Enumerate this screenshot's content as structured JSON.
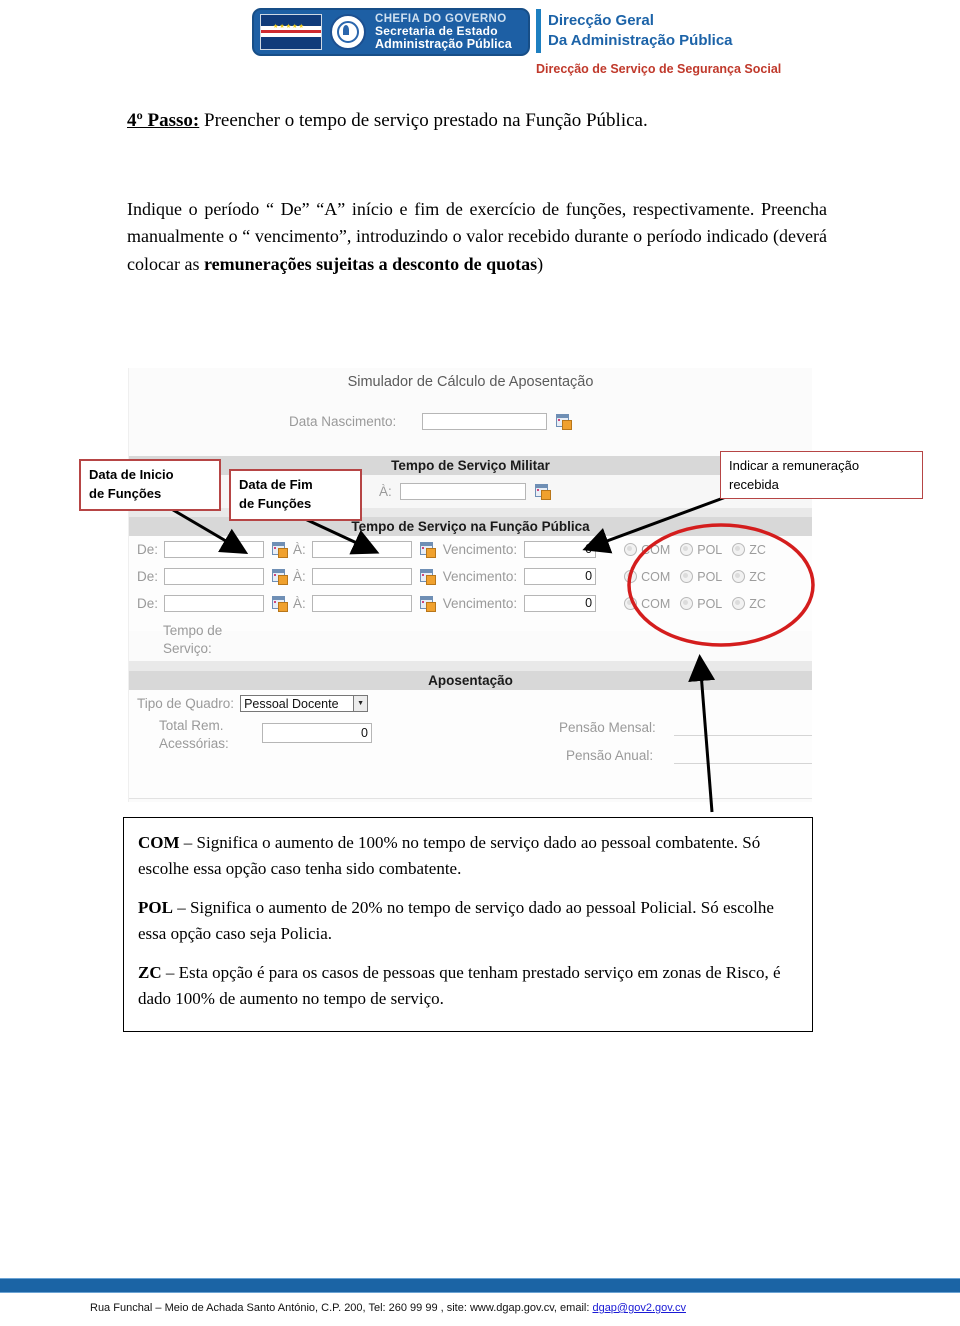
{
  "header": {
    "logo_line1": "CHEFIA DO GOVERNO",
    "logo_line2": "Secretaria de Estado",
    "logo_line3": "Administração Pública",
    "dg_line1": "Direcção Geral",
    "dg_line2": "Da Administração Pública",
    "service_line": "Direcção de Serviço de Segurança Social",
    "brand_blue": "#1d5fa4",
    "brand_red": "#c0392b"
  },
  "document": {
    "step_label": "4º Passo:",
    "step_text": " Preencher o tempo de serviço prestado na Função Pública.",
    "paragraph_part1": "Indique o período “ De” “A” início e fim de exercício de funções, respectivamente. Preencha manualmente o “ vencimento”, introduzindo o valor recebido durante o período indicado (deverá colocar as ",
    "paragraph_bold": "remunerações sujeitas a desconto de quotas",
    "paragraph_part2": ")"
  },
  "app": {
    "title": "Simulador de Cálculo de Aposentação",
    "birth_label": "Data Nascimento:",
    "birth_value": "",
    "military_band": "Tempo de Serviço Militar",
    "military_to_label": "À:",
    "military_to_value": "",
    "public_band": "Tempo de Serviço na Função Pública",
    "rows": [
      {
        "from_label": "De:",
        "from_value": "",
        "to_label": "À:",
        "to_value": "",
        "salary_label": "Vencimento:",
        "salary_value": "0",
        "opt1": "COM",
        "opt2": "POL",
        "opt3": "ZC"
      },
      {
        "from_label": "De:",
        "from_value": "",
        "to_label": "À:",
        "to_value": "",
        "salary_label": "Vencimento:",
        "salary_value": "0",
        "opt1": "COM",
        "opt2": "POL",
        "opt3": "ZC"
      },
      {
        "from_label": "De:",
        "from_value": "",
        "to_label": "À:",
        "to_value": "",
        "salary_label": "Vencimento:",
        "salary_value": "0",
        "opt1": "COM",
        "opt2": "POL",
        "opt3": "ZC"
      }
    ],
    "service_time_label_l1": "Tempo de",
    "service_time_label_l2": "Serviço:",
    "retire_band": "Aposentação",
    "quadro_label": "Tipo de Quadro:",
    "quadro_value": "Pessoal Docente",
    "total_rem_l1": "Total Rem.",
    "total_rem_l2": "Acessórias:",
    "total_rem_value": "0",
    "pensao_mensal_label": "Pensão Mensal:",
    "pensao_mensal_value": "",
    "pensao_anual_label": "Pensão Anual:",
    "pensao_anual_value": ""
  },
  "annotations": {
    "start_date": "Data de Inicio\nde Funções",
    "start_date_l1": "Data de Inicio",
    "start_date_l2": "de Funções",
    "end_date_l1": "Data de Fim",
    "end_date_l2": "de Funções",
    "remuneration_l1": "Indicar a remuneração",
    "remuneration_l2": "recebida",
    "callout_border": "#b64545",
    "highlight_circle": "#d41d1d"
  },
  "legend": {
    "com_bold": "COM",
    "com_text": " – Significa o aumento de 100% no tempo de serviço dado ao pessoal combatente. Só escolhe essa opção caso tenha sido combatente.",
    "pol_bold": "POL",
    "pol_text": " – Significa o aumento de 20% no tempo de serviço dado ao pessoal Policial. Só escolhe essa opção caso seja Policia.",
    "zc_bold": "ZC",
    "zc_text": " – Esta opção é para os casos de pessoas que tenham prestado serviço em zonas de Risco, é dado 100% de aumento no tempo de serviço."
  },
  "footer": {
    "text": "Rua Funchal – Meio de Achada Santo António, C.P. 200, Tel: 260 99 99 ,  site: www.dgap.gov.cv, email: ",
    "email": "dgap@gov2.gov.cv",
    "bar_color": "#1b64a5"
  }
}
